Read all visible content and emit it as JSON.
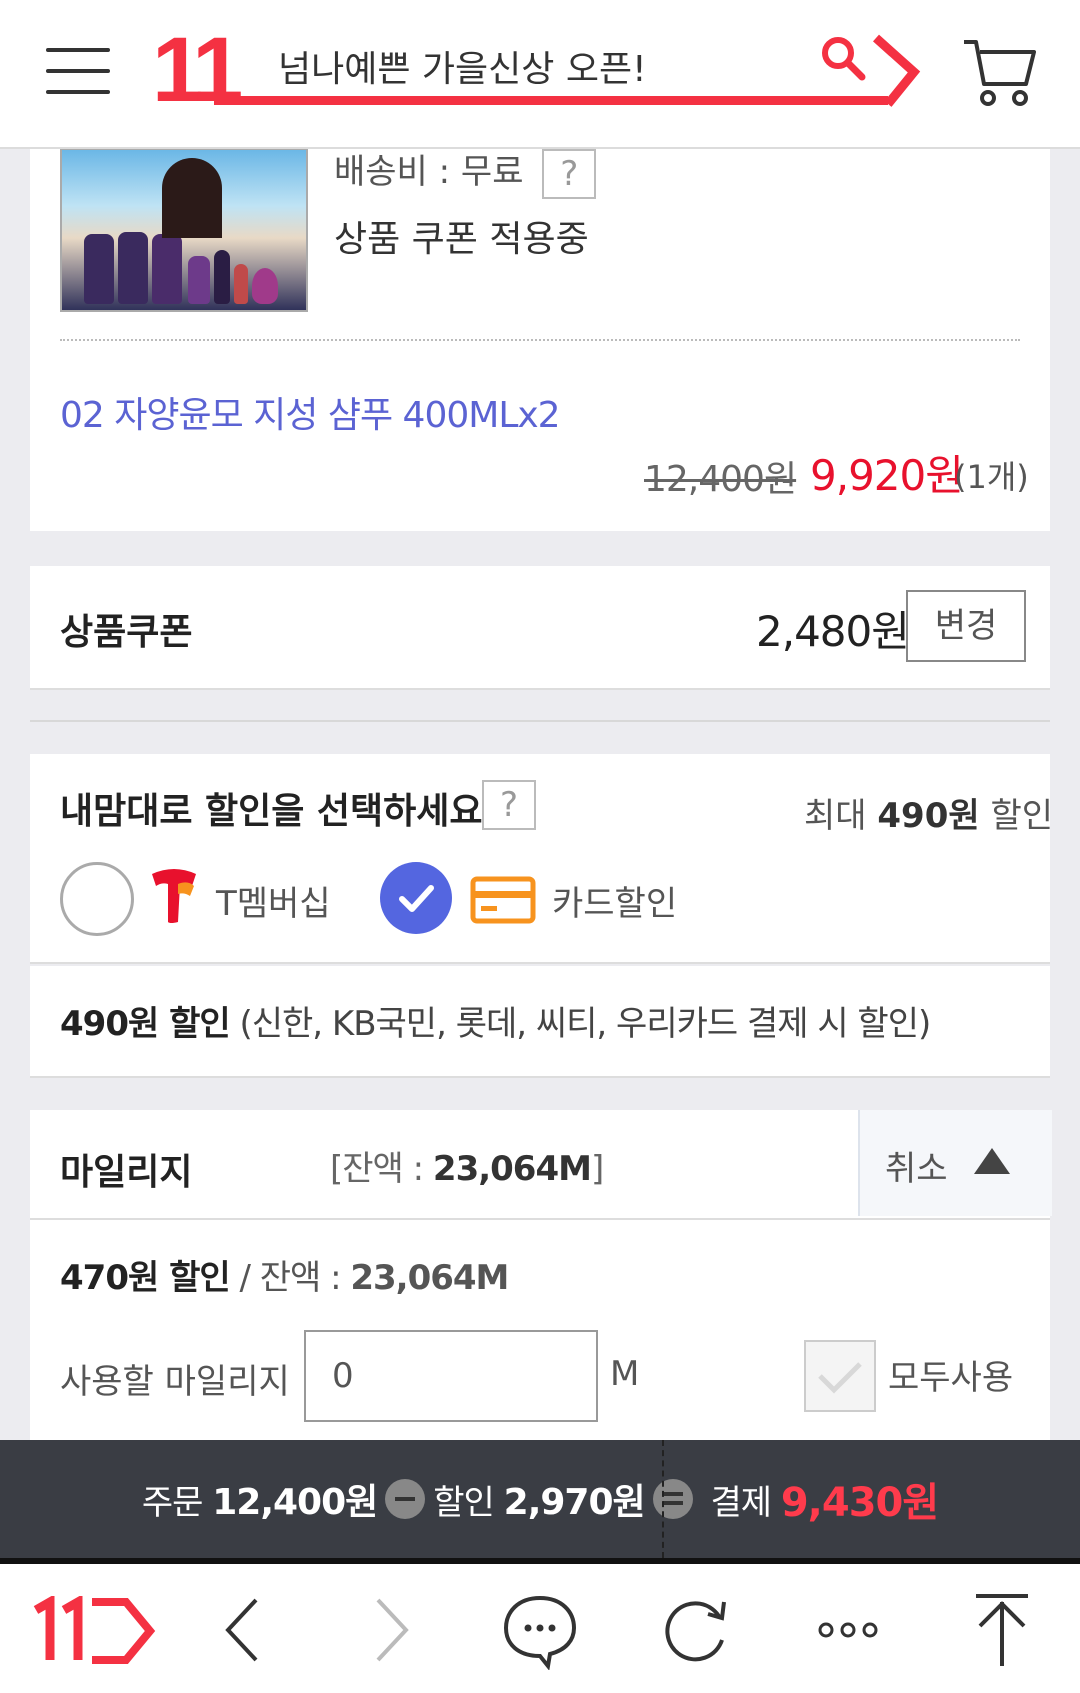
{
  "header": {
    "logo_text": "11",
    "search_text": "넘나예쁜 가을신상 오픈!",
    "brand_color": "#f43142"
  },
  "product": {
    "shipping_label": "배송비 : 무료",
    "shipping_help": "?",
    "coupon_applied": "상품 쿠폰 적용중",
    "option_name": "02 자양윤모 지성 샴푸 400MLx2",
    "original_price": "12,400원",
    "sale_price": "9,920원",
    "quantity": "(1개)"
  },
  "coupon": {
    "label": "상품쿠폰",
    "amount": "2,480원",
    "change_label": "변경"
  },
  "discount": {
    "title": "내맘대로 할인을 선택하세요",
    "help": "?",
    "max_prefix": "최대 ",
    "max_amount": "490원",
    "max_suffix": " 할인",
    "options": [
      {
        "label": "T멤버십",
        "selected": false,
        "icon": "t-membership-icon"
      },
      {
        "label": "카드할인",
        "selected": true,
        "icon": "credit-card-icon"
      }
    ],
    "info_amount": "490원 할인",
    "info_detail": " (신한, KB국민, 롯데, 씨티, 우리카드 결제 시 할인)",
    "accent_color": "#5466e0"
  },
  "mileage": {
    "title": "마일리지",
    "balance_prefix": "[잔액 : ",
    "balance_value": "23,064M",
    "balance_suffix": "]",
    "cancel_label": "취소",
    "discount_amount": "470원 할인",
    "discount_sep": " / 잔액 : ",
    "discount_balance": "23,064M",
    "use_label": "사용할 마일리지",
    "use_value": "0",
    "use_unit": "M",
    "use_all_label": "모두사용"
  },
  "summary": {
    "order_label": "주문",
    "order_amount": "12,400원",
    "discount_label": "할인",
    "discount_amount": "2,970원",
    "pay_label": "결제",
    "pay_amount": "9,430원"
  },
  "nav": {
    "items": [
      "home-11-icon",
      "back-icon",
      "forward-icon",
      "chat-icon",
      "refresh-icon",
      "more-icon",
      "scroll-top-icon"
    ]
  }
}
